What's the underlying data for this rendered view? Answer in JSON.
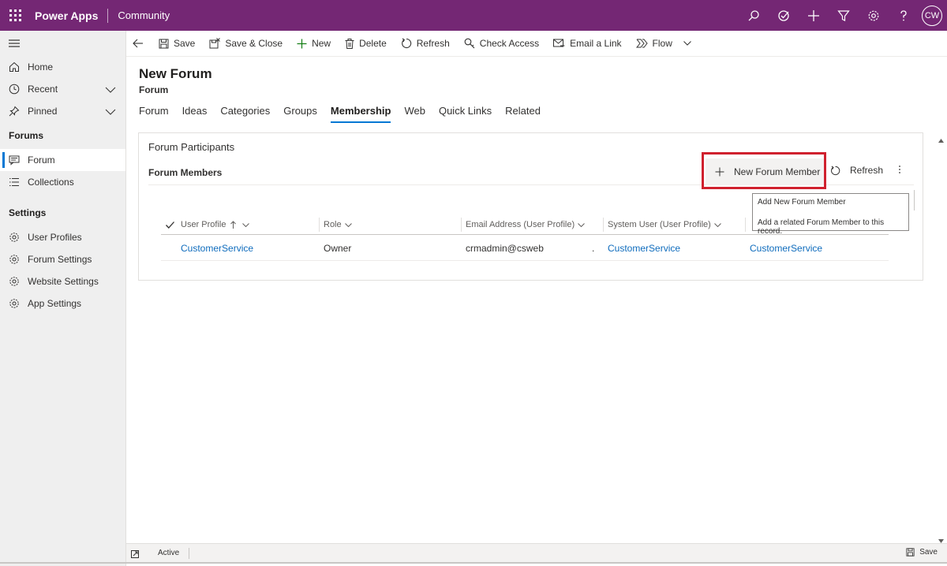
{
  "topbar": {
    "brand": "Power Apps",
    "app_name": "Community",
    "avatar_initials": "CW",
    "bg_color": "#742774"
  },
  "sidebar": {
    "nav": [
      {
        "label": "Home"
      },
      {
        "label": "Recent"
      },
      {
        "label": "Pinned"
      }
    ],
    "group_forums": "Forums",
    "forums_items": [
      {
        "label": "Forum"
      },
      {
        "label": "Collections"
      }
    ],
    "group_settings": "Settings",
    "settings_items": [
      {
        "label": "User Profiles"
      },
      {
        "label": "Forum Settings"
      },
      {
        "label": "Website Settings"
      },
      {
        "label": "App Settings"
      }
    ]
  },
  "commands": {
    "save": "Save",
    "save_close": "Save & Close",
    "new": "New",
    "delete": "Delete",
    "refresh": "Refresh",
    "check_access": "Check Access",
    "email_link": "Email a Link",
    "flow": "Flow"
  },
  "record": {
    "title": "New Forum",
    "entity": "Forum"
  },
  "tabs": [
    {
      "label": "Forum"
    },
    {
      "label": "Ideas"
    },
    {
      "label": "Categories"
    },
    {
      "label": "Groups"
    },
    {
      "label": "Membership"
    },
    {
      "label": "Web"
    },
    {
      "label": "Quick Links"
    },
    {
      "label": "Related"
    }
  ],
  "section": {
    "title": "Forum Participants",
    "subgrid_title": "Forum Members",
    "new_member_label": "New Forum Member",
    "refresh_label": "Refresh"
  },
  "grid": {
    "columns": [
      "User Profile",
      "Role",
      "Email Address (User Profile)",
      "System User (User Profile)"
    ],
    "rows": [
      {
        "user_profile": "CustomerService",
        "role": "Owner",
        "email": "crmadmin@csweb",
        "email_trail": ".",
        "system_user": "CustomerService",
        "extra": "CustomerService"
      }
    ]
  },
  "tooltip": {
    "title": "Add New Forum Member",
    "desc": "Add a related Forum Member to this record."
  },
  "status": {
    "state": "Active",
    "save": "Save"
  },
  "accent_color": "#0078d4",
  "highlight_color": "#d0212e"
}
